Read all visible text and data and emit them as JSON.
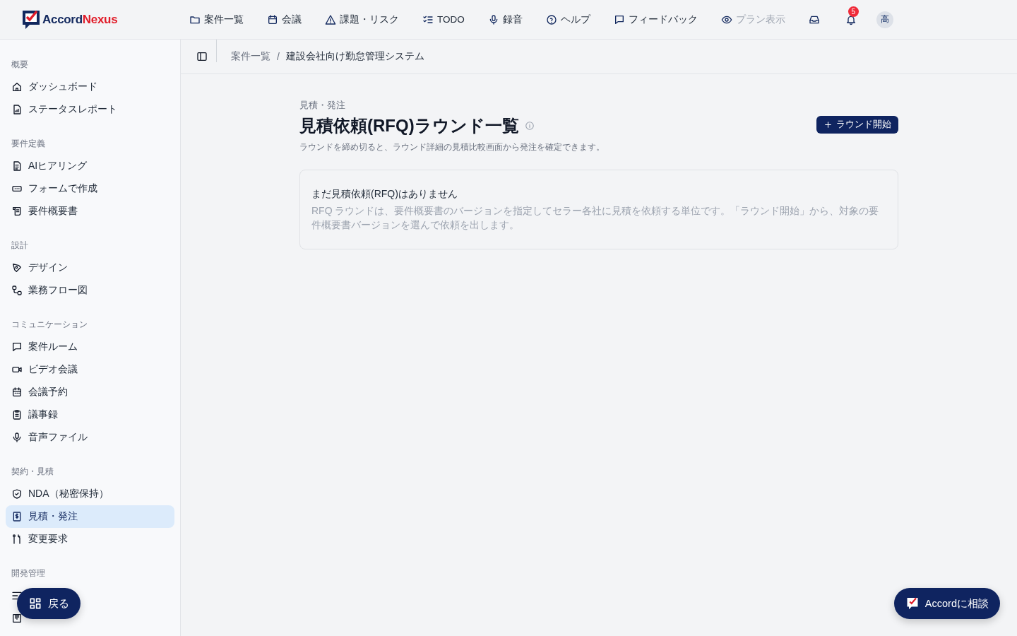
{
  "logo": {
    "part_1": "Accord",
    "part_2": "Nexus"
  },
  "nav": [
    {
      "label": "案件一覧",
      "disabled": false
    },
    {
      "label": "会議",
      "disabled": false
    },
    {
      "label": "課題・リスク",
      "disabled": false
    },
    {
      "label": "TODO",
      "disabled": false
    },
    {
      "label": "録音",
      "disabled": false
    },
    {
      "label": "ヘルプ",
      "disabled": false
    },
    {
      "label": "フィードバック",
      "disabled": false
    },
    {
      "label": "プラン表示",
      "disabled": true
    }
  ],
  "notifications": {
    "count": "5"
  },
  "avatar": {
    "initial": "高"
  },
  "breadcrumb": [
    "案件一覧",
    "/",
    "建設会社向け勤怠管理システム"
  ],
  "sidebar": {
    "sections": [
      {
        "title": "概要",
        "items": [
          {
            "label": "ダッシュボード",
            "selected": false
          },
          {
            "label": "ステータスレポート",
            "selected": false
          }
        ]
      },
      {
        "title": "要件定義",
        "items": [
          {
            "label": "AIヒアリング",
            "selected": false
          },
          {
            "label": "フォームで作成",
            "selected": false
          },
          {
            "label": "要件概要書",
            "selected": false
          }
        ]
      },
      {
        "title": "設計",
        "items": [
          {
            "label": "デザイン",
            "selected": false
          },
          {
            "label": "業務フロー図",
            "selected": false
          }
        ]
      },
      {
        "title": "コミュニケーション",
        "items": [
          {
            "label": "案件ルーム",
            "selected": false
          },
          {
            "label": "ビデオ会議",
            "selected": false
          },
          {
            "label": "会議予約",
            "selected": false
          },
          {
            "label": "議事録",
            "selected": false
          },
          {
            "label": "音声ファイル",
            "selected": false
          }
        ]
      },
      {
        "title": "契約・見積",
        "items": [
          {
            "label": "NDA（秘密保持）",
            "selected": false
          },
          {
            "label": "見積・発注",
            "selected": true
          },
          {
            "label": "変更要求",
            "selected": false
          }
        ]
      },
      {
        "title": "開発管理",
        "items": [
          {
            "selected": false
          },
          {
            "selected": false
          }
        ]
      }
    ]
  },
  "page": {
    "eyebrow": "見積・発注",
    "title": "見積依頼(RFQ)ラウンド一覧",
    "subtitle": "ラウンドを締め切ると、ラウンド詳細の見積比較画面から発注を確定できます。",
    "primary_button": "ラウンド開始"
  },
  "empty_state": {
    "title": "まだ見積依頼(RFQ)はありません",
    "body": "RFQ ラウンドは、要件概要書のバージョンを指定してセラー各社に見積を依頼する単位です。「ラウンド開始」から、対象の要件概要書バージョンを選んで依頼を出します。"
  },
  "back_button": "戻る",
  "consult_button": "Accordに相談"
}
